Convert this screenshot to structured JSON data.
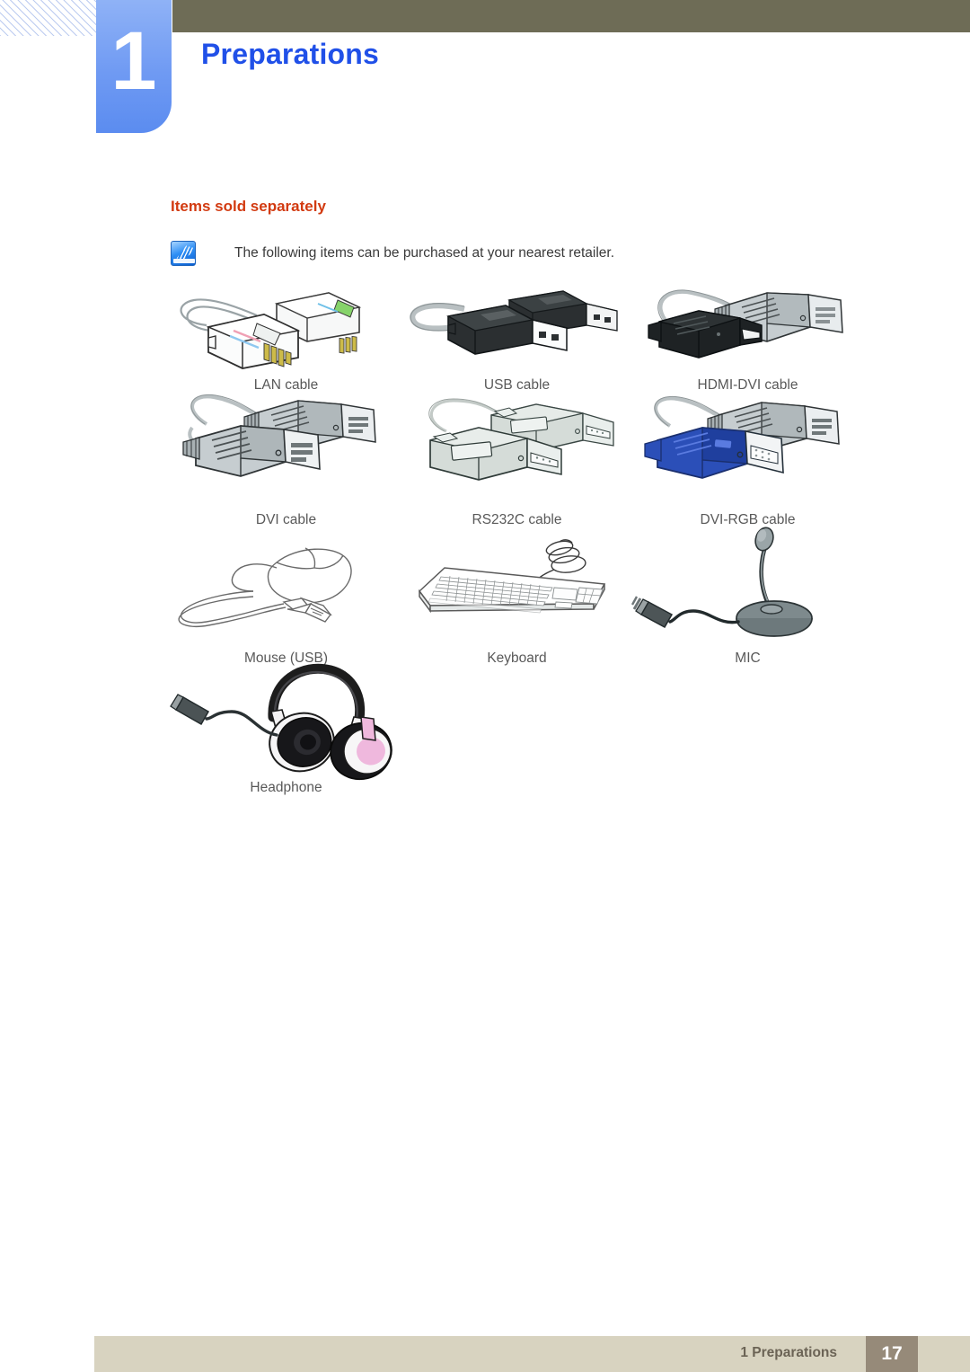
{
  "header": {
    "chapter_number": "1",
    "chapter_title": "Preparations"
  },
  "section": {
    "title": "Items sold separately",
    "note_icon": "note-pen-icon",
    "note_text": "The following items can be purchased at your nearest retailer."
  },
  "items": [
    {
      "label": "LAN cable",
      "art": "lan-cable-illustration"
    },
    {
      "label": "USB cable",
      "art": "usb-cable-illustration"
    },
    {
      "label": "HDMI-DVI cable",
      "art": "hdmi-dvi-cable-illustration"
    },
    {
      "label": "DVI cable",
      "art": "dvi-cable-illustration"
    },
    {
      "label": "RS232C cable",
      "art": "rs232c-cable-illustration"
    },
    {
      "label": "DVI-RGB cable",
      "art": "dvi-rgb-cable-illustration"
    },
    {
      "label": "Mouse (USB)",
      "art": "mouse-illustration"
    },
    {
      "label": "Keyboard",
      "art": "keyboard-illustration"
    },
    {
      "label": "MIC",
      "art": "microphone-illustration"
    },
    {
      "label": "Headphone",
      "art": "headphone-illustration"
    }
  ],
  "footer": {
    "label": "1 Preparations",
    "page_number": "17"
  },
  "colors": {
    "chapter_badge": "#6f9af3",
    "chapter_title": "#2050e8",
    "header_bar": "#6e6c56",
    "section_title": "#d23a10",
    "body_text": "#3a3a3a",
    "item_label": "#595959",
    "footer_bar": "#d8d3c0",
    "page_box": "#968a79",
    "hatch": "#b9c9ef"
  }
}
